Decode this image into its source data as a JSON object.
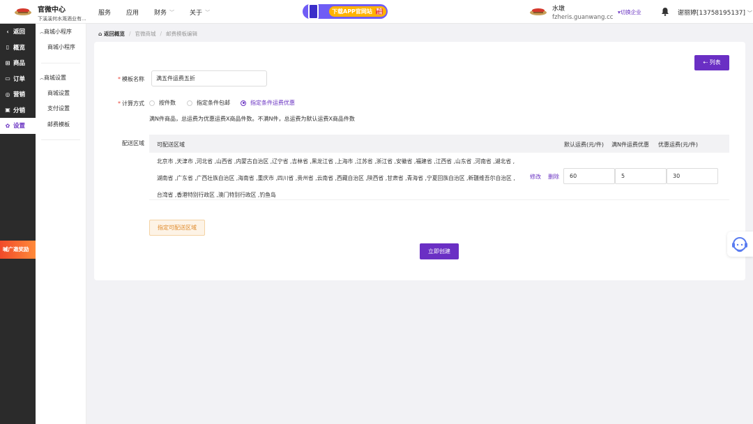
{
  "header": {
    "brand_title": "官微中心",
    "brand_subtitle": "下溪溪何水溉酒业有...",
    "nav": [
      {
        "label": "服务",
        "has_caret": false
      },
      {
        "label": "应用",
        "has_caret": false
      },
      {
        "label": "财务",
        "has_caret": true
      },
      {
        "label": "关于",
        "has_caret": true
      }
    ],
    "promo_text": "下载APP官网站",
    "promo_tag": "新品上线",
    "company_name": "水墩",
    "company_domain": "fzheris.guanwang.cc",
    "switch_label": "切换企业",
    "user": "谢丽婷[13758195137]"
  },
  "rail": {
    "items": [
      {
        "icon": "back-icon",
        "glyph": "‹",
        "label": "返回"
      },
      {
        "icon": "overview-icon",
        "glyph": "▯",
        "label": "概览"
      },
      {
        "icon": "goods-icon",
        "glyph": "⊞",
        "label": "商品"
      },
      {
        "icon": "order-icon",
        "glyph": "▭",
        "label": "订单"
      },
      {
        "icon": "marketing-icon",
        "glyph": "◎",
        "label": "营销"
      },
      {
        "icon": "distribution-icon",
        "glyph": "▣",
        "label": "分销"
      },
      {
        "icon": "settings-icon",
        "glyph": "✿",
        "label": "设置"
      }
    ],
    "active_index": 6,
    "badge": "喊广邀奖励"
  },
  "sidebar": {
    "group1": "商城小程序",
    "group1_items": [
      "商城小程序"
    ],
    "group2": "商城设置",
    "group2_items": [
      "商城设置",
      "支付设置",
      "邮费模板"
    ]
  },
  "breadcrumb": {
    "home": "返回概览",
    "items": [
      "官微商城",
      "邮费模板编辑"
    ]
  },
  "form": {
    "list_button": "列表",
    "name_label": "模板名称",
    "name_value": "满五件运费五折",
    "calc_label": "计算方式",
    "calc_options": [
      "按件数",
      "指定条件包邮",
      "指定条件运费优惠"
    ],
    "calc_selected": 2,
    "hint": "满N件商品，总运费为优惠运费X商品件数。不满N件，总运费为默认运费X商品件数",
    "region_label": "配送区域",
    "table_headers": {
      "region": "可配送区域",
      "default_fee": "默认运费(元/件)",
      "threshold": "满N件运费优惠",
      "discount_fee": "优惠运费(元/件)"
    },
    "regions_line1": "北京市 ,天津市 ,河北省 ,山西省 ,内蒙古自治区 ,辽宁省 ,吉林省 ,黑龙江省 ,上海市 ,江苏省 ,浙江省 ,安徽省 ,福建省 ,江西省 ,山东省 ,河南省 ,湖北省 ,",
    "regions_line2": "湖南省 ,广东省 ,广西壮族自治区 ,海南省 ,重庆市 ,四川省 ,贵州省 ,云南省 ,西藏自治区 ,陕西省 ,甘肃省 ,青海省 ,宁夏回族自治区 ,新疆维吾尔自治区 ,",
    "regions_line3": "台湾省 ,香港特别行政区 ,澳门特别行政区 ,钓鱼岛",
    "edit": "修改",
    "delete": "删除",
    "default_fee": "60",
    "threshold": "5",
    "discount_fee": "30",
    "add_area_button": "指定可配送区域",
    "create_button": "立即创建"
  }
}
